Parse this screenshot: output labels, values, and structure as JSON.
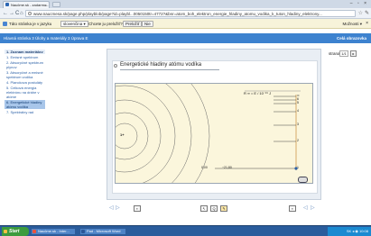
{
  "browser": {
    "tab_title": "Naučme.sk - zadarmo...",
    "tab_close": "×",
    "window_buttons": "– ▫ ×",
    "back_glyph": "←",
    "forward_glyph": "→",
    "reload_glyph": "C",
    "home_glyph": "⌂",
    "url": "www.naucmesa.sk/page.php/playblob/page?id=playbl...0050150tr=4772?&bnr=atom_boh_elektron_energie_hladiny_atomu_vodika_k_tuton_hladiny_elektrony...",
    "star_glyph": "☆",
    "wrench_glyph": "✎"
  },
  "translate_bar": {
    "text": "Táto stránka je v jazyku",
    "language": "slovenčina ▾",
    "question": "Chcete ju preložiť?",
    "translate_button": "Preložiť",
    "no_button": "Nie",
    "options": "Možnosti ▾",
    "close": "×"
  },
  "app_header": {
    "title": "Hlavná stránka 3 Úlohy a materiály 3 Úprava E",
    "right_link": "Celá obrazovka"
  },
  "sidebar": {
    "items": [
      {
        "label": "1. Zoznam materiálov",
        "state": "head"
      },
      {
        "label": "1. Emisné spektrum",
        "state": ""
      },
      {
        "label": "2. Absorpčné spektrum plynov",
        "state": ""
      },
      {
        "label": "3. Absorpčné a emisné spektrum vodíka",
        "state": ""
      },
      {
        "label": "4. Planckova postuláty",
        "state": ""
      },
      {
        "label": "5. Celková energia elektrónu na dráhe v atóme",
        "state": ""
      },
      {
        "label": "6. Energetické hladiny atómu vodíka",
        "state": "active"
      },
      {
        "label": "7. Spektrálny rad",
        "state": ""
      }
    ]
  },
  "main": {
    "page_label": "strana",
    "page_num": "1/1",
    "page_go": "▸",
    "card_title": "Energetické hladiny atómu vodíka"
  },
  "simulation": {
    "header": "R ∞  =  E / 10⁻¹⁹ J",
    "level_labels": [
      "∞",
      "6",
      "5",
      "4",
      "3",
      "2",
      "1"
    ],
    "energy_left": "0,00",
    "energy_value": "−21,80",
    "proton_label": "1+"
  },
  "bottom_nav": {
    "prev_glyph": "◁",
    "next_glyph": "▷",
    "box_left": "▪",
    "cursor_tool": "↖",
    "zoom_tool": "Q",
    "pen_tool": "✎",
    "box_right": "▪"
  },
  "taskbar": {
    "start": "Start",
    "items": [
      "Naučme.sk - Inter...",
      "Pad - Microsoft Word"
    ],
    "tray": "SK  ◂ ◉ 10:08"
  },
  "colors": {
    "app_header": "#3d82cf",
    "sim_background": "#fbf6dc",
    "sidebar_active": "#a8c6ea",
    "taskbar": "#2a5c9c"
  }
}
